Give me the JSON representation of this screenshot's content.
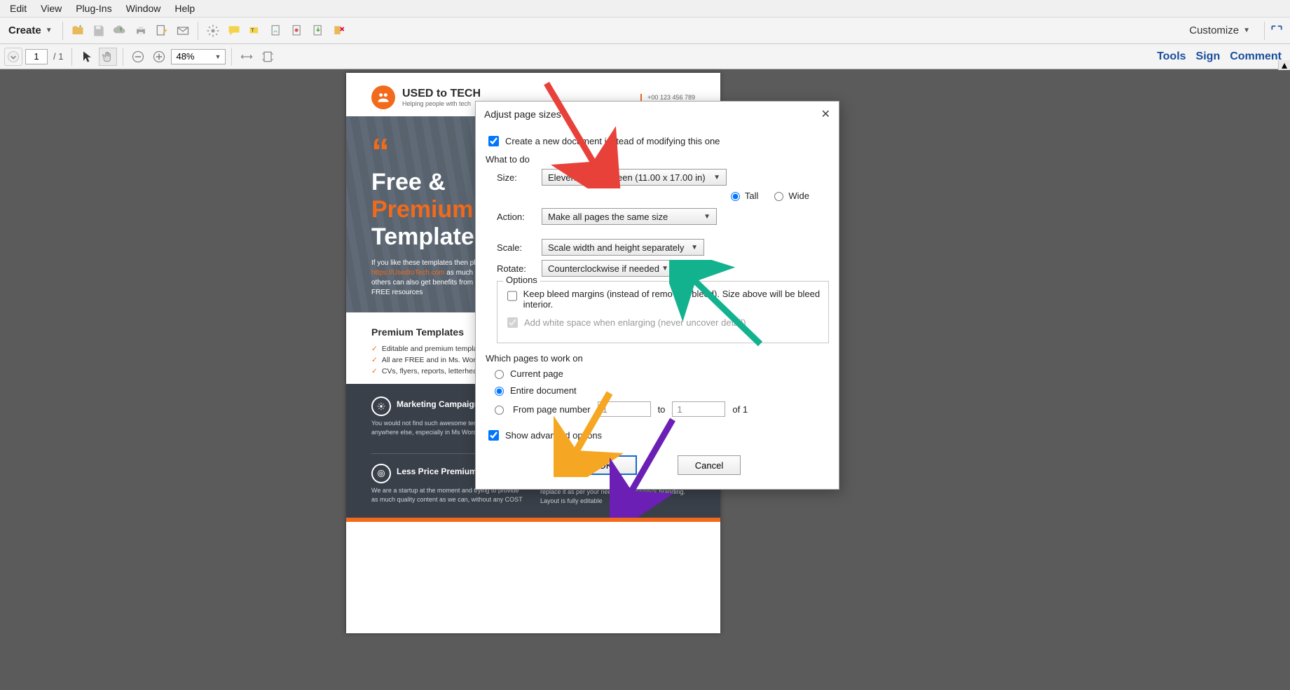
{
  "menubar": [
    "Edit",
    "View",
    "Plug-Ins",
    "Window",
    "Help"
  ],
  "toolbar": {
    "create_label": "Create",
    "customize_label": "Customize"
  },
  "nav": {
    "page_value": "1",
    "page_total": "/ 1",
    "zoom_value": "48%",
    "links": [
      "Tools",
      "Sign",
      "Comment"
    ]
  },
  "pdf": {
    "brand_main": "USED to TECH",
    "brand_sub": "Helping people with tech",
    "phone": "+00 123 456 789",
    "hero_line1": "Free &",
    "hero_line2": "Premium",
    "hero_line3": "Templates",
    "hero_small_pre": "If you like these templates then please share ",
    "hero_small_link": "https://UsedtoTech.com",
    "hero_small_post": " as much as you can so that others can also get benefits from this. These are FREE resources",
    "prem_title": "Premium Templates",
    "prem_items": [
      "Editable and premium templates",
      "All are FREE and in Ms. Word format",
      "CVs, flyers, reports, letterheads, etc."
    ],
    "mk_h": "Marketing Campaign",
    "mk_p": "You would not find such awesome templates for FREE anywhere else, especially in Ms Word",
    "lp_h": "Less Price Premium Quality",
    "lp_p": "We are a startup at the moment and trying to provide as much quality content as we can, without any COST",
    "gr_p": "replace it as per your needs or company's branding. Layout is fully editable"
  },
  "dialog": {
    "title": "Adjust page sizes",
    "create_new_label": "Create a new document instead of modifying this one",
    "what_to_do": "What to do",
    "size_lbl": "Size:",
    "size_val": "Eleven by seventeen (11.00 x 17.00 in)",
    "tall": "Tall",
    "wide": "Wide",
    "action_lbl": "Action:",
    "action_val": "Make all pages the same size",
    "scale_lbl": "Scale:",
    "scale_val": "Scale width and height separately",
    "rotate_lbl": "Rotate:",
    "rotate_val": "Counterclockwise if needed",
    "options_title": "Options",
    "opt1": "Keep bleed margins (instead of removing bleed). Size above will be bleed interior.",
    "opt2": "Add white space when enlarging (never uncover detail)",
    "which_title": "Which pages to work on",
    "which_current": "Current page",
    "which_entire": "Entire document",
    "which_from": "From page number",
    "which_to": "to",
    "which_of": "of 1",
    "page_from_val": "1",
    "page_to_val": "1",
    "show_adv": "Show advanced options",
    "ok": "OK",
    "cancel": "Cancel"
  }
}
